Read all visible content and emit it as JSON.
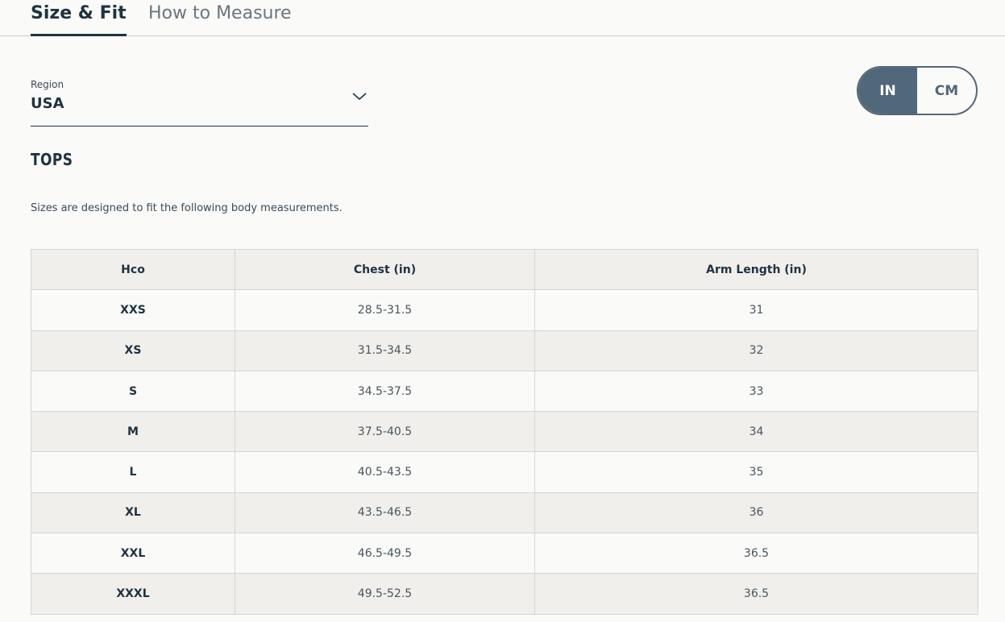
{
  "tabs": [
    {
      "label": "Size & Fit",
      "active": true
    },
    {
      "label": "How to Measure",
      "active": false
    }
  ],
  "region": {
    "label": "Region",
    "value": "USA",
    "icon": "chevron-down-icon"
  },
  "units": {
    "options": [
      "IN",
      "CM"
    ],
    "selected": "IN"
  },
  "section": {
    "title": "TOPS",
    "description": "Sizes are designed to fit the following body measurements."
  },
  "table": {
    "headers": [
      "Hco",
      "Chest (in)",
      "Arm Length (in)"
    ],
    "rows": [
      [
        "XXS",
        "28.5-31.5",
        "31"
      ],
      [
        "XS",
        "31.5-34.5",
        "32"
      ],
      [
        "S",
        "34.5-37.5",
        "33"
      ],
      [
        "M",
        "37.5-40.5",
        "34"
      ],
      [
        "L",
        "40.5-43.5",
        "35"
      ],
      [
        "XL",
        "43.5-46.5",
        "36"
      ],
      [
        "XXL",
        "46.5-49.5",
        "36.5"
      ],
      [
        "XXXL",
        "49.5-52.5",
        "36.5"
      ]
    ]
  },
  "colors": {
    "text": "#1e3242",
    "toggle_active": "#51687a",
    "row_alt": "#f0efec",
    "background": "#fafaf8"
  }
}
